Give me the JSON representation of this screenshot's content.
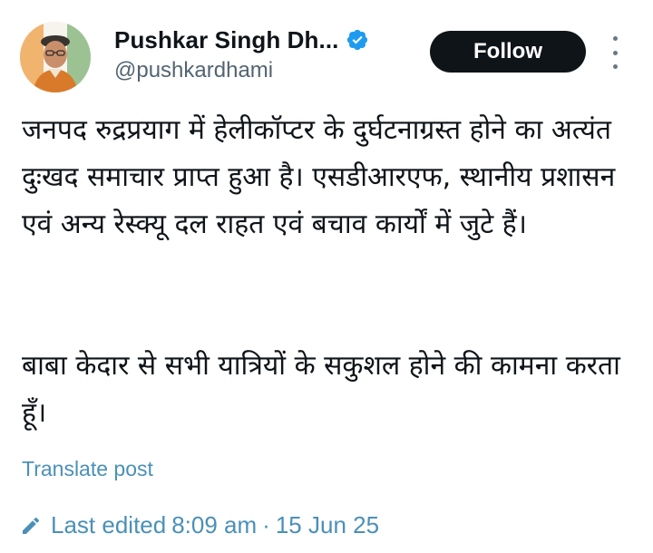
{
  "header": {
    "display_name": "Pushkar Singh Dh...",
    "handle": "@pushkardhami",
    "follow_label": "Follow",
    "verified_icon": "verified-badge-icon",
    "more_icon": "more-vertical-icon"
  },
  "post": {
    "paragraph1": "जनपद रुद्रप्रयाग में हेलीकॉप्टर के दुर्घटनाग्रस्त होने का अत्यंत दुःखद समाचार प्राप्त हुआ है। एसडीआरएफ, स्थानीय प्रशासन एवं अन्य रेस्क्यू दल राहत एवं बचाव कार्यों में जुटे हैं।",
    "paragraph2": "बाबा केदार से सभी यात्रियों के सकुशल होने की कामना करता हूँ।",
    "translate_label": "Translate post"
  },
  "footer": {
    "edited_label": "Last edited",
    "time": "8:09 am",
    "separator": "·",
    "date": "15 Jun 25",
    "edit_icon": "pencil-icon"
  },
  "colors": {
    "link": "#4a90b8",
    "verified": "#1d9bf0",
    "text": "#0f1419",
    "muted": "#536471",
    "button_bg": "#0f1419"
  }
}
